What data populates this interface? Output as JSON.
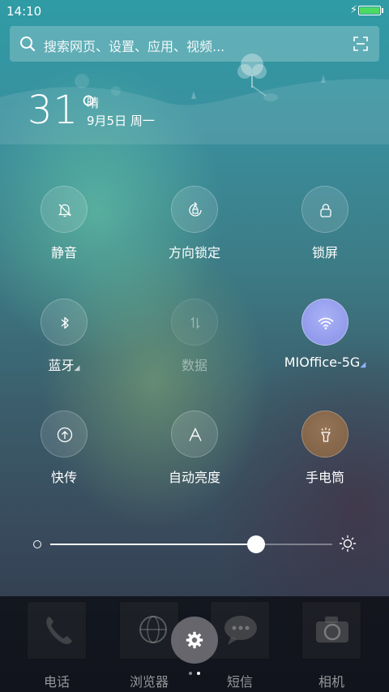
{
  "status": {
    "time": "14:10"
  },
  "search": {
    "placeholder": "搜索网页、设置、应用、视频..."
  },
  "weather": {
    "temp": "31°",
    "condition": "晴",
    "date": "9月5日 周一"
  },
  "toggles": [
    {
      "label": "静音",
      "icon": "bell-mute-icon",
      "state": "off"
    },
    {
      "label": "方向锁定",
      "icon": "rotation-lock-icon",
      "state": "off"
    },
    {
      "label": "锁屏",
      "icon": "lock-icon",
      "state": "off"
    },
    {
      "label": "蓝牙",
      "icon": "bluetooth-icon",
      "state": "off"
    },
    {
      "label": "数据",
      "icon": "mobile-data-icon",
      "state": "disabled"
    },
    {
      "label": "MIOffice-5G",
      "icon": "wifi-icon",
      "state": "on"
    },
    {
      "label": "快传",
      "icon": "quick-transfer-icon",
      "state": "off"
    },
    {
      "label": "自动亮度",
      "icon": "auto-brightness-icon",
      "state": "off"
    },
    {
      "label": "手电筒",
      "icon": "flashlight-icon",
      "state": "active"
    }
  ],
  "brightness": {
    "level": 0.73
  },
  "dock": {
    "apps": [
      {
        "label": "电话",
        "icon": "phone-icon"
      },
      {
        "label": "浏览器",
        "icon": "browser-globe-icon"
      },
      {
        "label": "短信",
        "icon": "messages-icon"
      },
      {
        "label": "相机",
        "icon": "camera-icon"
      }
    ],
    "page_count": 2,
    "current_page": 2
  },
  "colors": {
    "wifi_active": "#9aa3f0",
    "flashlight_active": "#8a6a4a",
    "battery_fill": "#4cd964"
  }
}
